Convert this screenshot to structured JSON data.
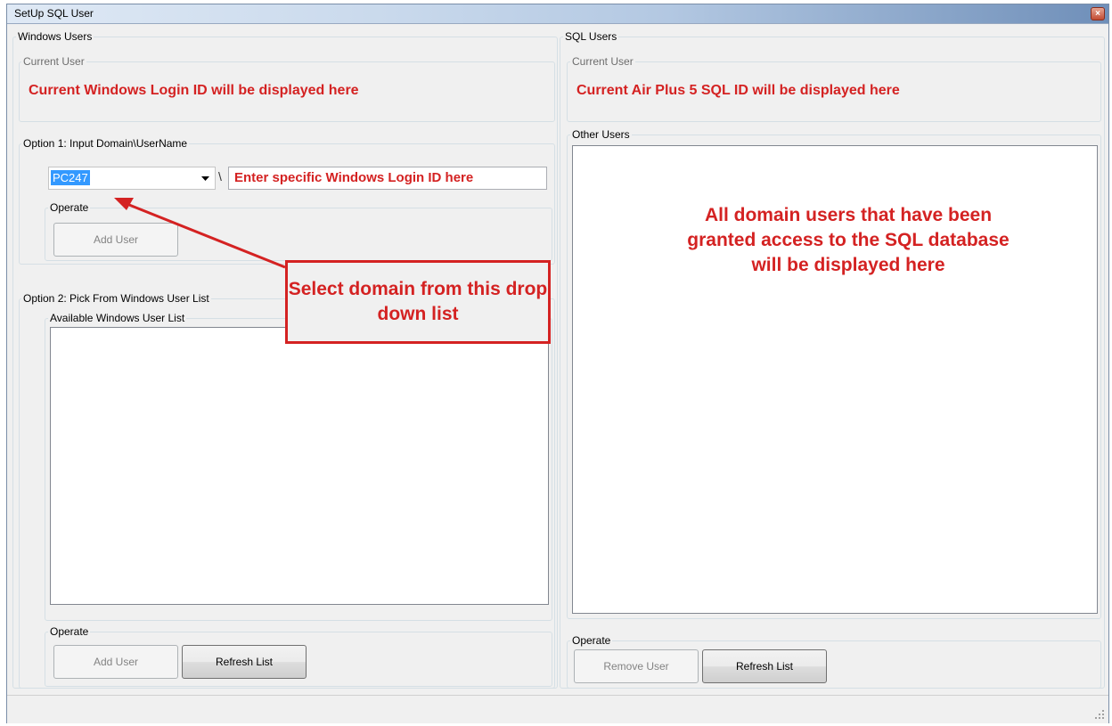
{
  "window": {
    "title": "SetUp SQL User",
    "close_glyph": "×"
  },
  "windows_users": {
    "legend": "Windows Users",
    "current_user_legend": "Current User",
    "current_user_note": "Current Windows Login ID will be displayed here",
    "option1": {
      "legend": "Option 1: Input Domain\\UserName",
      "domain_value": "PC247",
      "separator": "\\",
      "username_hint": "Enter specific Windows Login ID here",
      "operate_legend": "Operate",
      "add_user_label": "Add User"
    },
    "option2": {
      "legend": "Option 2: Pick From Windows User List",
      "list_legend": "Available Windows User List",
      "operate_legend": "Operate",
      "add_user_label": "Add User",
      "refresh_label": "Refresh List"
    }
  },
  "sql_users": {
    "legend": "SQL Users",
    "current_user_legend": "Current User",
    "current_user_note": "Current Air Plus 5 SQL ID will be displayed here",
    "other_users_legend": "Other Users",
    "other_users_note": "All domain users that have been granted access to the SQL database will be displayed here",
    "operate_legend": "Operate",
    "remove_user_label": "Remove User",
    "refresh_label": "Refresh List"
  },
  "callout": {
    "text": "Select domain from this drop down list",
    "color": "#d42222"
  }
}
